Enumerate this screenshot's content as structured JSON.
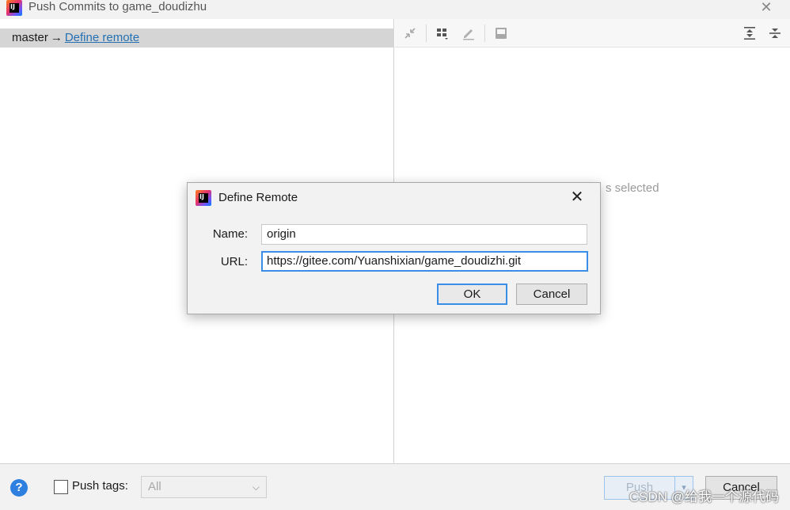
{
  "window": {
    "title": "Push Commits to game_doudizhu",
    "close_icon": "close-icon"
  },
  "left_pane": {
    "branch": "master",
    "arrow": "→",
    "define_remote_link": "Define remote"
  },
  "right_pane": {
    "toolbar_icons": [
      "collapse-arrows-icon",
      "group-by-icon",
      "edit-icon",
      "show-diff-icon",
      "expand-all-icon",
      "collapse-all-icon"
    ],
    "empty_text": "s selected"
  },
  "bottom_bar": {
    "help_label": "?",
    "push_tags_label": "Push tags:",
    "tags_select_value": "All",
    "push_label": "Push",
    "cancel_label": "Cancel",
    "watermark": "CSDN @给我一个源代码"
  },
  "dialog": {
    "title": "Define Remote",
    "name_label": "Name:",
    "name_value": "origin",
    "url_label": "URL:",
    "url_value": "https://gitee.com/Yuanshixian/game_doudizhi.git",
    "ok_label": "OK",
    "cancel_label": "Cancel"
  },
  "colors": {
    "accent": "#3a8ee6",
    "link": "#2470b3",
    "help": "#2f7fe0"
  }
}
